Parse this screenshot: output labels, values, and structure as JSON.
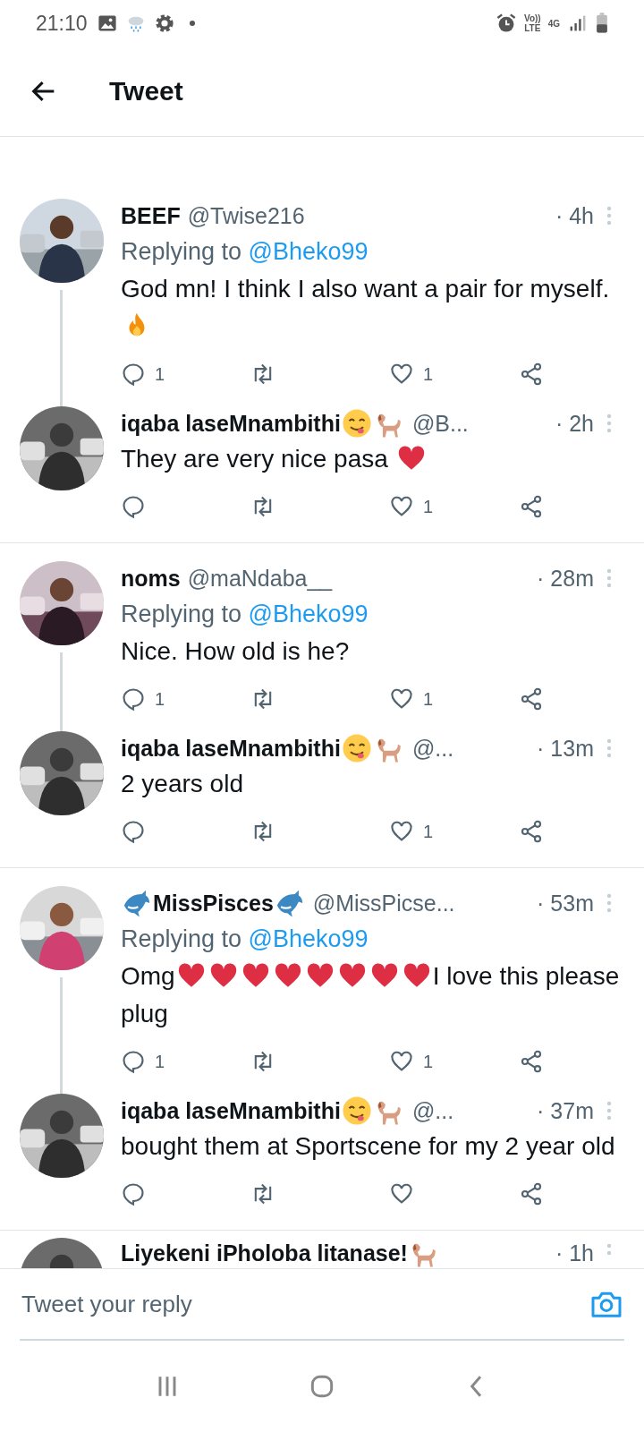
{
  "status_bar": {
    "time": "21:10",
    "volte_top": "Vo))",
    "volte_bottom": "LTE",
    "network": "4G"
  },
  "header": {
    "title": "Tweet"
  },
  "threads": [
    {
      "tweets": [
        {
          "name": [
            {
              "kind": "text",
              "text": "BEEF"
            }
          ],
          "handle": "@Twise216",
          "time": "· 4h",
          "replying_label": "Replying to",
          "replying_to": "@Bheko99",
          "body": [
            {
              "kind": "text",
              "text": "God mn! I think I also want a pair for myself. "
            },
            {
              "kind": "fire"
            }
          ],
          "reply_count": "1",
          "like_count": "1"
        },
        {
          "name": [
            {
              "kind": "text",
              "text": "iqaba laseMnambithi "
            },
            {
              "kind": "smiley"
            },
            {
              "kind": "dog"
            }
          ],
          "handle": "@B...",
          "time": "· 2h",
          "body": [
            {
              "kind": "text",
              "text": "They are very nice pasa "
            },
            {
              "kind": "heart"
            }
          ],
          "like_count": "1"
        }
      ]
    },
    {
      "tweets": [
        {
          "name": [
            {
              "kind": "text",
              "text": "noms"
            }
          ],
          "handle": "@maNdaba__",
          "time": "· 28m",
          "replying_label": "Replying to",
          "replying_to": "@Bheko99",
          "body": [
            {
              "kind": "text",
              "text": "Nice. How old is he?"
            }
          ],
          "reply_count": "1",
          "like_count": "1"
        },
        {
          "name": [
            {
              "kind": "text",
              "text": "iqaba laseMnambithi "
            },
            {
              "kind": "smiley"
            },
            {
              "kind": "dog"
            }
          ],
          "handle": "@...",
          "time": "· 13m",
          "body": [
            {
              "kind": "text",
              "text": "2 years old"
            }
          ],
          "like_count": "1"
        }
      ]
    },
    {
      "tweets": [
        {
          "name": [
            {
              "kind": "dolphin"
            },
            {
              "kind": "text",
              "text": "MissPisces"
            },
            {
              "kind": "dolphin"
            }
          ],
          "handle": "@MissPicse...",
          "time": "· 53m",
          "replying_label": "Replying to",
          "replying_to": "@Bheko99",
          "body": [
            {
              "kind": "text",
              "text": "Omg"
            },
            {
              "kind": "heart"
            },
            {
              "kind": "heart"
            },
            {
              "kind": "heart"
            },
            {
              "kind": "heart"
            },
            {
              "kind": "heart"
            },
            {
              "kind": "heart"
            },
            {
              "kind": "heart"
            },
            {
              "kind": "heart"
            },
            {
              "kind": "text",
              "text": "I love this please plug"
            }
          ],
          "reply_count": "1",
          "like_count": "1"
        },
        {
          "name": [
            {
              "kind": "text",
              "text": "iqaba laseMnambithi "
            },
            {
              "kind": "smiley"
            },
            {
              "kind": "dog"
            }
          ],
          "handle": "@...",
          "time": "· 37m",
          "body": [
            {
              "kind": "text",
              "text": "bought them at Sportscene for my 2 year old"
            }
          ]
        }
      ]
    }
  ],
  "partial_tweet": {
    "name": [
      {
        "kind": "text",
        "text": "Liyekeni iPholoba litanase!"
      },
      {
        "kind": "dog"
      }
    ],
    "time": "· 1h"
  },
  "reply_bar": {
    "placeholder": "Tweet your reply"
  }
}
